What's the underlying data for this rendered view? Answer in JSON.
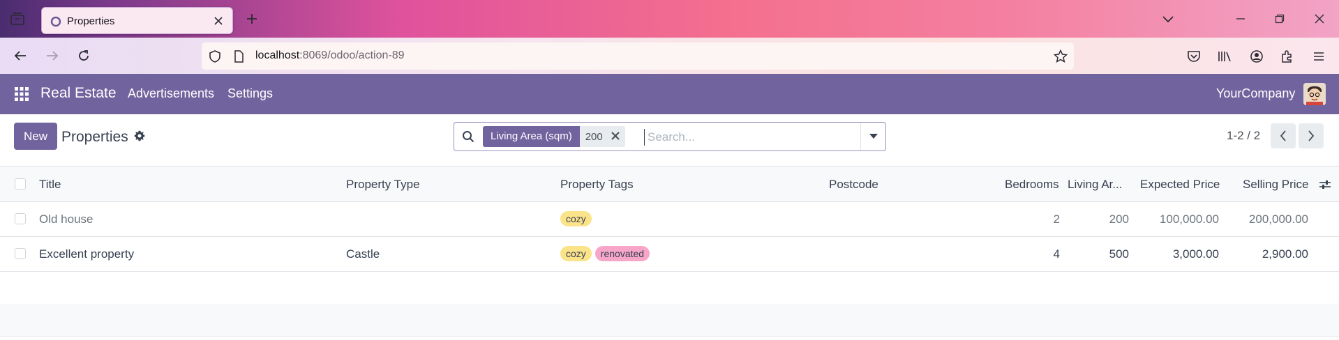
{
  "browser": {
    "tab_title": "Properties",
    "url_host": "localhost",
    "url_path": ":8069/odoo/action-89"
  },
  "navbar": {
    "app_name": "Real Estate",
    "menu": [
      "Advertisements",
      "Settings"
    ],
    "company": "YourCompany"
  },
  "control_panel": {
    "new_label": "New",
    "title": "Properties",
    "facet_label": "Living Area (sqm)",
    "facet_value": "200",
    "search_placeholder": "Search...",
    "pager": "1-2 / 2"
  },
  "list": {
    "columns": [
      "Title",
      "Property Type",
      "Property Tags",
      "Postcode",
      "Bedrooms",
      "Living Ar...",
      "Expected Price",
      "Selling Price"
    ],
    "rows": [
      {
        "title": "Old house",
        "type": "",
        "tags": [
          "cozy"
        ],
        "postcode": "",
        "bedrooms": "2",
        "living_area": "200",
        "expected_price": "100,000.00",
        "selling_price": "200,000.00",
        "muted": true
      },
      {
        "title": "Excellent property",
        "type": "Castle",
        "tags": [
          "cozy",
          "renovated"
        ],
        "postcode": "",
        "bedrooms": "4",
        "living_area": "500",
        "expected_price": "3,000.00",
        "selling_price": "2,900.00",
        "muted": false
      }
    ]
  },
  "colors": {
    "brand": "#71639e",
    "tag_cozy": "#fbe38a",
    "tag_renovated": "#f7a6c9"
  }
}
